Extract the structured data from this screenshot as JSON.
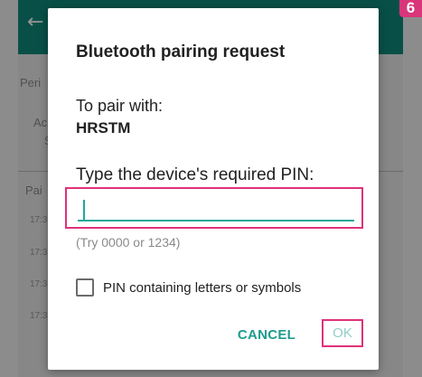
{
  "background": {
    "left_fragments": [
      "Peri",
      "Ac",
      "S",
      "Pai"
    ],
    "times": [
      "17:3",
      "17:3",
      "17:3",
      "17:3"
    ]
  },
  "badge": {
    "text": "6"
  },
  "dialog": {
    "title": "Bluetooth pairing request",
    "pair_with_label": "To pair with:",
    "device_name": "HRSTM",
    "pin_prompt": "Type the device's required PIN:",
    "pin_value": "",
    "pin_hint": "(Try 0000 or 1234)",
    "checkbox_label": "PIN containing letters or symbols",
    "checkbox_checked": false,
    "cancel_label": "CANCEL",
    "ok_label": "OK"
  },
  "colors": {
    "accent": "#20a79a",
    "highlight": "#e0317a",
    "appbar": "#0f8a7a"
  }
}
